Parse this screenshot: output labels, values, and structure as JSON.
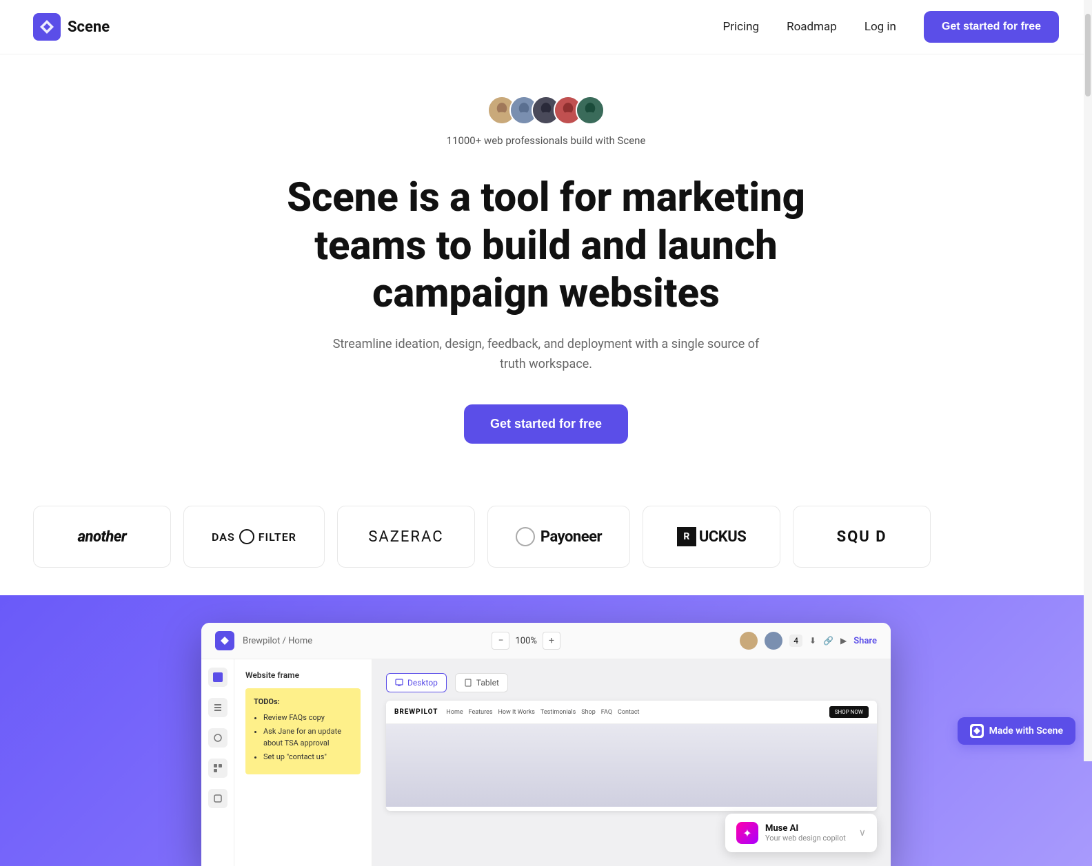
{
  "navbar": {
    "logo_text": "Scene",
    "nav_links": [
      {
        "label": "Pricing",
        "id": "pricing"
      },
      {
        "label": "Roadmap",
        "id": "roadmap"
      },
      {
        "label": "Log in",
        "id": "login"
      }
    ],
    "cta_button": "Get started for free"
  },
  "hero": {
    "social_proof": "11000+ web professionals build with Scene",
    "title": "Scene is a tool for marketing teams to build and launch campaign websites",
    "subtitle": "Streamline ideation, design, feedback, and deployment with a single source of truth workspace.",
    "cta_button": "Get started for free"
  },
  "logo_bar": {
    "logos": [
      {
        "id": "another",
        "label": "another",
        "style": "italic"
      },
      {
        "id": "das-filter",
        "label": "DAS FILTER",
        "style": "normal"
      },
      {
        "id": "sazerac",
        "label": "SAZERAC",
        "style": "normal"
      },
      {
        "id": "payoneer",
        "label": "Payoneer",
        "style": "normal"
      },
      {
        "id": "ruckus",
        "label": "UCKUS",
        "style": "normal"
      },
      {
        "id": "squd",
        "label": "SQU D",
        "style": "normal"
      }
    ]
  },
  "app_preview": {
    "breadcrumb": "Brewpilot / Home",
    "zoom": "100%",
    "share_label": "Share",
    "panel": {
      "title": "Website frame",
      "device_tabs": [
        "Desktop",
        "Tablet"
      ]
    },
    "sticky_note": {
      "title": "TODOs:",
      "items": [
        "Review FAQs copy",
        "Ask Jane for an update about TSA approval",
        "Set up \"contact us\""
      ]
    },
    "site": {
      "logo": "BREWPILOT",
      "nav_links": [
        "Home",
        "Features",
        "How It Works",
        "Testimonials",
        "Shop",
        "FAQ",
        "Contact"
      ],
      "shop_now": "SHOP NOW"
    },
    "muse_ai": {
      "title": "Muse AI",
      "subtitle": "Your web design copilot"
    }
  },
  "made_with": {
    "label": "Made with Scene"
  }
}
